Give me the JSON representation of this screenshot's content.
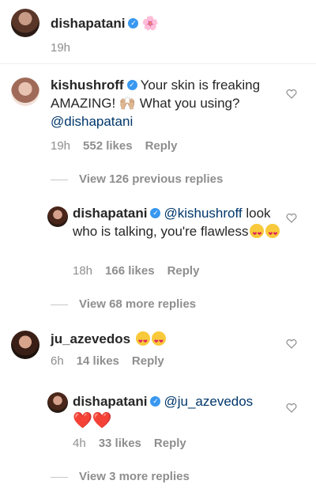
{
  "post": {
    "username": "dishapatani",
    "emoji": "🌸",
    "time": "19h"
  },
  "comments": [
    {
      "username": "kishushroff",
      "text_before": "Your skin is freaking AMAZING! ",
      "emoji": "🙌🏼",
      "text_after": " What you using? ",
      "mention": "@dishapatani",
      "time": "19h",
      "likes": "552 likes",
      "reply": "Reply",
      "view_replies": "View 126 previous replies"
    },
    {
      "username": "dishapatani",
      "mention": "@kishushroff",
      "text": "look who is talking, you're flawless",
      "time": "18h",
      "likes": "166 likes",
      "reply": "Reply",
      "view_replies": "View 68 more replies"
    },
    {
      "username": "ju_azevedos",
      "time": "6h",
      "likes": "14 likes",
      "reply": "Reply"
    },
    {
      "username": "dishapatani",
      "mention": "@ju_azevedos",
      "emoji": "❤️❤️",
      "time": "4h",
      "likes": "33 likes",
      "reply": "Reply",
      "view_replies": "View 3 more replies"
    }
  ],
  "icons": {
    "verified": "verified-badge-icon",
    "like": "heart-outline-icon",
    "emoji_face": "heart-eyes-emoji-icon"
  },
  "colors": {
    "text": "#262626",
    "muted": "#8e8e8e",
    "mention": "#00376b",
    "verified": "#3897f0"
  }
}
